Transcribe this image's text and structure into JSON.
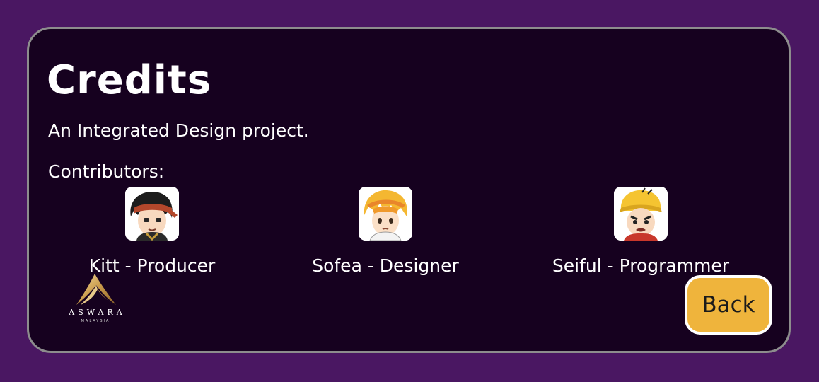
{
  "page": {
    "title": "Credits",
    "subtitle": "An Integrated Design project.",
    "contributors_heading": "Contributors:"
  },
  "contributors": [
    {
      "label": "Kitt - Producer",
      "avatar_icon": "avatar-headband-icon"
    },
    {
      "label": "Sofea - Designer",
      "avatar_icon": "avatar-orange-hair-icon"
    },
    {
      "label": "Seiful - Programmer",
      "avatar_icon": "avatar-yellow-cap-icon"
    }
  ],
  "logo": {
    "name": "ASWARA",
    "sub": "MALAYSIA"
  },
  "back_button": {
    "label": "Back"
  },
  "colors": {
    "background": "#4a1762",
    "panel": "#16011f",
    "panel_border": "#8d8d8d",
    "button": "#efb43c",
    "text": "#ffffff"
  }
}
